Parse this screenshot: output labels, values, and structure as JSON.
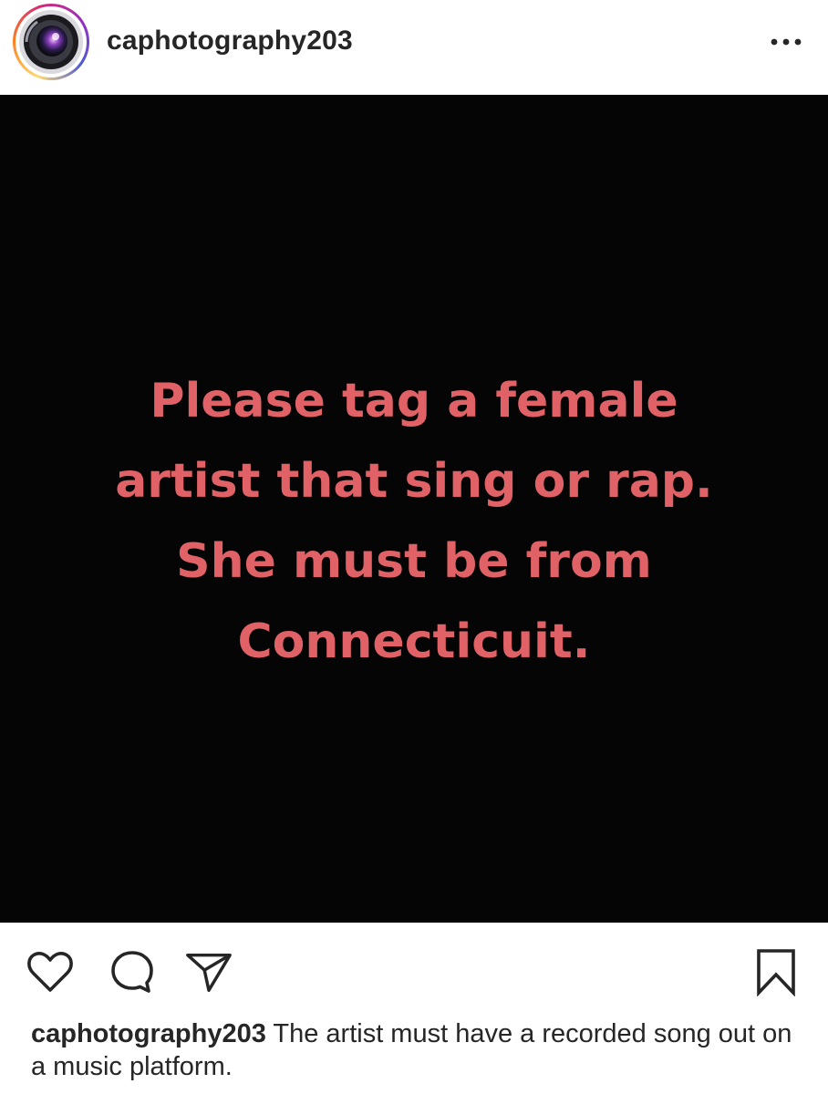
{
  "header": {
    "username": "caphotography203",
    "avatar_icon": "camera-lens-icon",
    "more_icon": "more-options-icon"
  },
  "media": {
    "lines": [
      "Please tag a female",
      "artist that sing or rap.",
      "She must be from",
      "Connecticuit."
    ],
    "text_color": "#e06266",
    "background_color": "#050505"
  },
  "actions": {
    "icons": [
      "heart-icon",
      "comment-icon",
      "share-icon",
      "bookmark-icon"
    ]
  },
  "caption": {
    "username": "caphotography203",
    "text": " The artist must have a recorded song out on a music platform."
  }
}
